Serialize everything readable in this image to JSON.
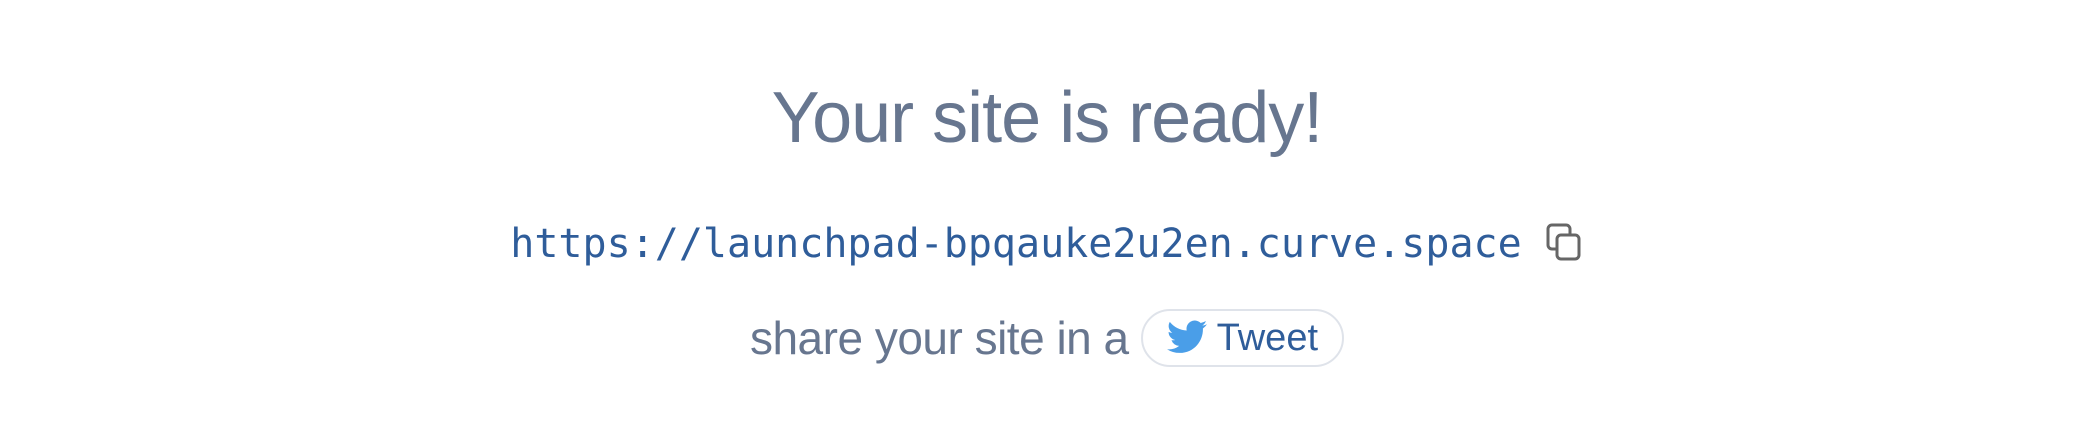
{
  "heading": "Your site is ready!",
  "site_url": "https://launchpad-bpqauke2u2en.curve.space",
  "copy_icon": "copy-icon",
  "share": {
    "text": "share your site in a",
    "button_label": "Tweet",
    "button_icon": "twitter-bird-icon"
  },
  "colors": {
    "heading": "#67768f",
    "link": "#2f5d9a",
    "twitter": "#4a9ee8",
    "icon": "#666666",
    "button_border": "#dfe3ea"
  }
}
